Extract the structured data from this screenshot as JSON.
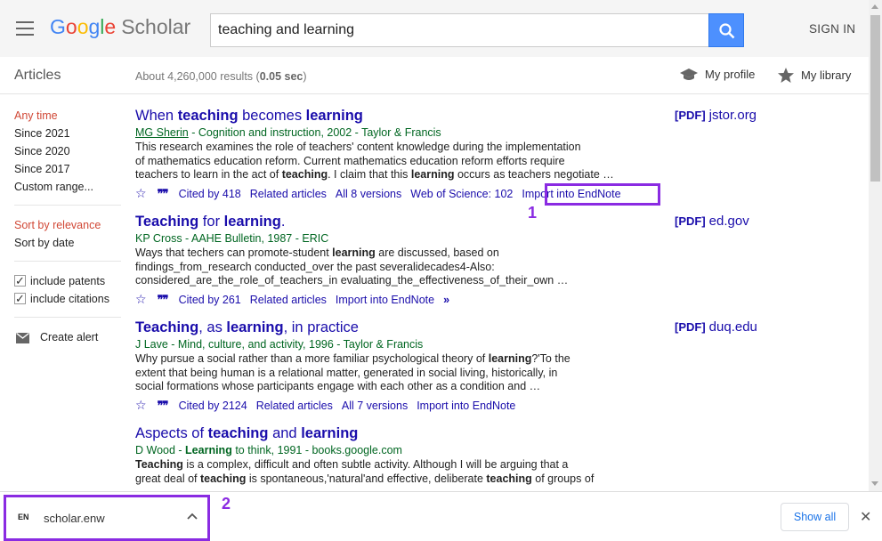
{
  "header": {
    "logo": {
      "google": [
        "G",
        "o",
        "o",
        "g",
        "l",
        "e"
      ],
      "scholar": "Scholar"
    },
    "search_value": "teaching and learning",
    "sign_in": "SIGN IN"
  },
  "subbar": {
    "articles": "Articles",
    "results_prefix": "About 4,260,000 results (",
    "results_time": "0.05 sec",
    "results_suffix": ")",
    "my_profile": "My profile",
    "my_library": "My library"
  },
  "sidebar": {
    "time_filters": [
      "Any time",
      "Since 2021",
      "Since 2020",
      "Since 2017",
      "Custom range..."
    ],
    "sort": [
      "Sort by relevance",
      "Sort by date"
    ],
    "checks": [
      "include patents",
      "include citations"
    ],
    "create_alert": "Create alert"
  },
  "results": [
    {
      "title_parts": [
        [
          "When ",
          false
        ],
        [
          "teaching",
          true
        ],
        [
          " becomes ",
          false
        ],
        [
          "learning",
          true
        ]
      ],
      "authors_link": "MG Sherin",
      "authors_rest": " - Cognition and instruction, 2002 - Taylor & Francis",
      "snippet": [
        [
          [
            "This research examines the role of teachers' content knowledge during the implementation",
            false
          ]
        ],
        [
          [
            "of mathematics education reform. Current mathematics education reform efforts require",
            false
          ]
        ],
        [
          [
            "teachers to learn in the act of ",
            false
          ],
          [
            "teaching",
            true
          ],
          [
            ". I claim that this ",
            false
          ],
          [
            "learning",
            true
          ],
          [
            " occurs as teachers negotiate …",
            false
          ]
        ]
      ],
      "actions": [
        "Cited by 418",
        "Related articles",
        "All 8 versions",
        "Web of Science: 102",
        "Import into EndNote"
      ],
      "pdf_tag": "[PDF]",
      "pdf_domain": "jstor.org"
    },
    {
      "title_parts": [
        [
          "Teaching",
          true
        ],
        [
          " for ",
          false
        ],
        [
          "learning",
          true
        ],
        [
          ".",
          false
        ]
      ],
      "authors_rest": "KP Cross - AAHE Bulletin, 1987 - ERIC",
      "snippet": [
        [
          [
            "Ways that techers can promote-student ",
            false
          ],
          [
            "learning",
            true
          ],
          [
            " are discussed, based on",
            false
          ]
        ],
        [
          [
            "findings_from_research conducted_over the past severalidecades4-Also:",
            false
          ]
        ],
        [
          [
            "considered_are_the_role_of_teachers_in evaluating_the_effectiveness_of_their_own …",
            false
          ]
        ]
      ],
      "actions": [
        "Cited by 261",
        "Related articles",
        "Import into EndNote"
      ],
      "more_icon": "»",
      "pdf_tag": "[PDF]",
      "pdf_domain": "ed.gov"
    },
    {
      "title_parts": [
        [
          "Teaching",
          true
        ],
        [
          ", as ",
          false
        ],
        [
          "learning",
          true
        ],
        [
          ", in practice",
          false
        ]
      ],
      "authors_rest": "J Lave - Mind, culture, and activity, 1996 - Taylor & Francis",
      "snippet": [
        [
          [
            "Why pursue a social rather than a more familiar psychological theory of ",
            false
          ],
          [
            "learning",
            true
          ],
          [
            "?'To the",
            false
          ]
        ],
        [
          [
            "extent that being human is a relational matter, generated in social living, historically, in",
            false
          ]
        ],
        [
          [
            "social formations whose participants engage with each other as a condition and …",
            false
          ]
        ]
      ],
      "actions": [
        "Cited by 2124",
        "Related articles",
        "All 7 versions",
        "Import into EndNote"
      ],
      "pdf_tag": "[PDF]",
      "pdf_domain": "duq.edu"
    },
    {
      "title_parts": [
        [
          "Aspects of ",
          false
        ],
        [
          "teaching",
          true
        ],
        [
          " and ",
          false
        ],
        [
          "learning",
          true
        ]
      ],
      "authors_parts": [
        [
          "D Wood - ",
          false
        ],
        [
          "Learning",
          true
        ],
        [
          " to think, 1991 - books.google.com",
          false
        ]
      ],
      "snippet": [
        [
          [
            "Teaching",
            true
          ],
          [
            " is a complex, difficult and often subtle activity. Although I will be arguing that a",
            false
          ]
        ],
        [
          [
            "great deal of ",
            false
          ],
          [
            "teaching",
            true
          ],
          [
            " is spontaneous,'natural'and effective, deliberate ",
            false
          ],
          [
            "teaching",
            true
          ],
          [
            " of groups of",
            false
          ]
        ]
      ]
    }
  ],
  "annotations": {
    "one": "1",
    "two": "2"
  },
  "download_bar": {
    "icon_text": "EN",
    "file_name": "scholar.enw",
    "show_all": "Show all"
  },
  "colors": {
    "accent": "#8a2be2",
    "link": "#1a0dab",
    "green": "#006621",
    "active": "#d14836"
  }
}
